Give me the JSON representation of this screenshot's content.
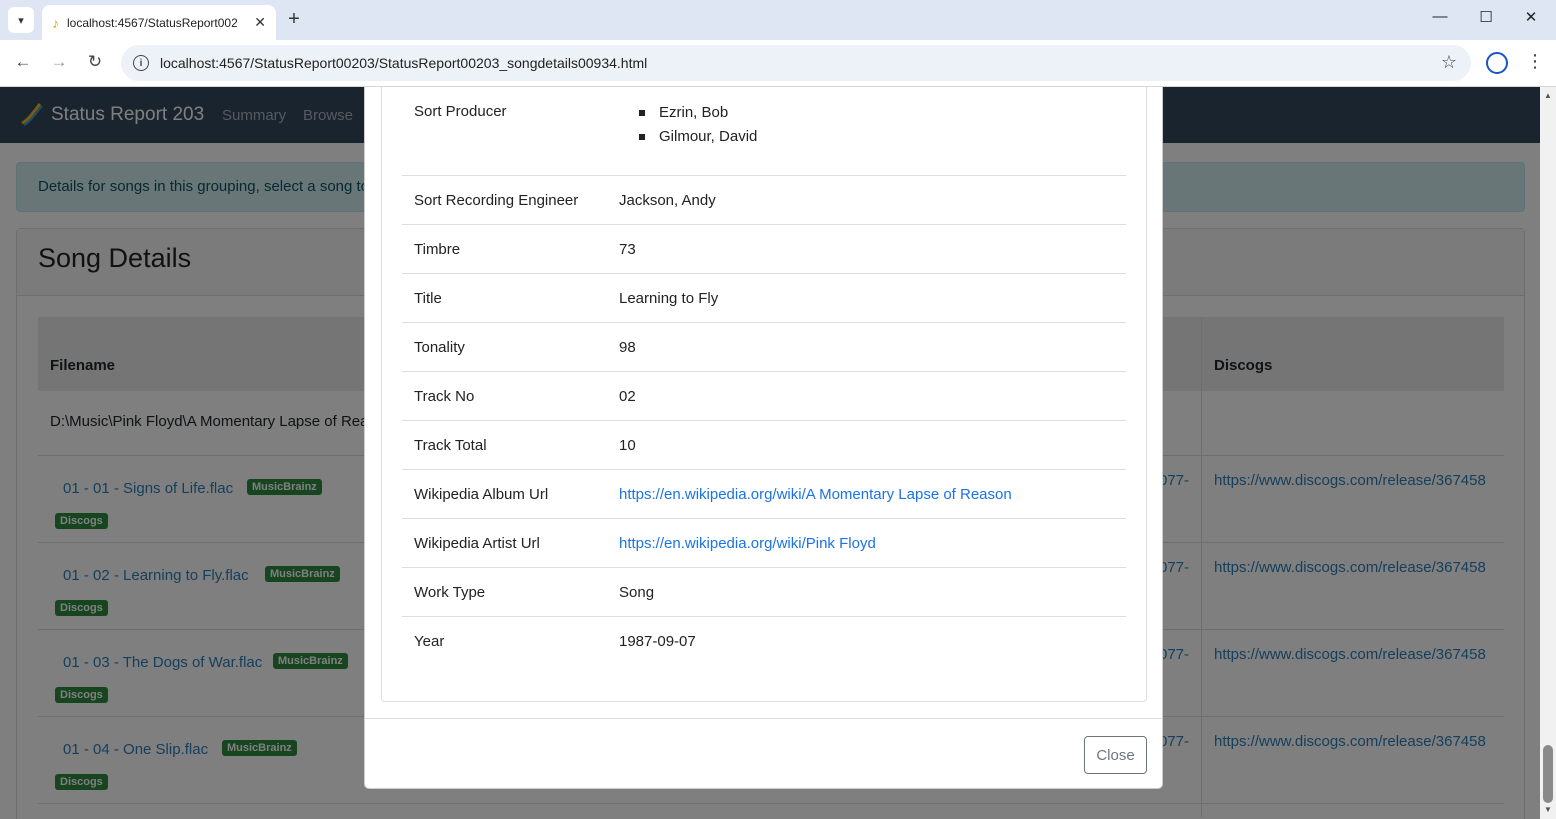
{
  "browser": {
    "tab_title": "localhost:4567/StatusReport00203/StatusReport00203_songdetails00934.html",
    "url": "localhost:4567/StatusReport00203/StatusReport00203_songdetails00934.html"
  },
  "app": {
    "brand": "Status Report 203",
    "nav": [
      "Summary",
      "Browse"
    ]
  },
  "alert_text": "Details for songs in this grouping, select a song to",
  "card_title": "Song Details",
  "table": {
    "headers": [
      "Filename",
      "Discogs"
    ],
    "path_row": "D:\\Music\\Pink Floyd\\A Momentary Lapse of Rea",
    "cut_text": "077-",
    "badges": {
      "musicbrainz": "MusicBrainz",
      "discogs": "Discogs"
    },
    "songs": [
      {
        "file": "01 - 01 - Signs of Life.flac",
        "discogs": "https://www.discogs.com/release/367458"
      },
      {
        "file": "01 - 02 - Learning to Fly.flac",
        "discogs": "https://www.discogs.com/release/367458"
      },
      {
        "file": "01 - 03 - The Dogs of War.flac",
        "discogs": "https://www.discogs.com/release/367458"
      },
      {
        "file": "01 - 04 - One Slip.flac",
        "discogs": "https://www.discogs.com/release/367458"
      }
    ]
  },
  "modal": {
    "producer_label": "Sort Producer",
    "producers": [
      "Ezrin, Bob",
      "Gilmour, David"
    ],
    "rows": [
      {
        "key": "Sort Recording Engineer",
        "value": "Jackson, Andy"
      },
      {
        "key": "Timbre",
        "value": "73"
      },
      {
        "key": "Title",
        "value": "Learning to Fly"
      },
      {
        "key": "Tonality",
        "value": "98"
      },
      {
        "key": "Track No",
        "value": "02"
      },
      {
        "key": "Track Total",
        "value": "10"
      },
      {
        "key": "Wikipedia Album Url",
        "value": "https://en.wikipedia.org/wiki/A Momentary Lapse of Reason",
        "link": true
      },
      {
        "key": "Wikipedia Artist Url",
        "value": "https://en.wikipedia.org/wiki/Pink Floyd",
        "link": true
      },
      {
        "key": "Work Type",
        "value": "Song"
      },
      {
        "key": "Year",
        "value": "1987-09-07"
      }
    ],
    "close_label": "Close"
  }
}
